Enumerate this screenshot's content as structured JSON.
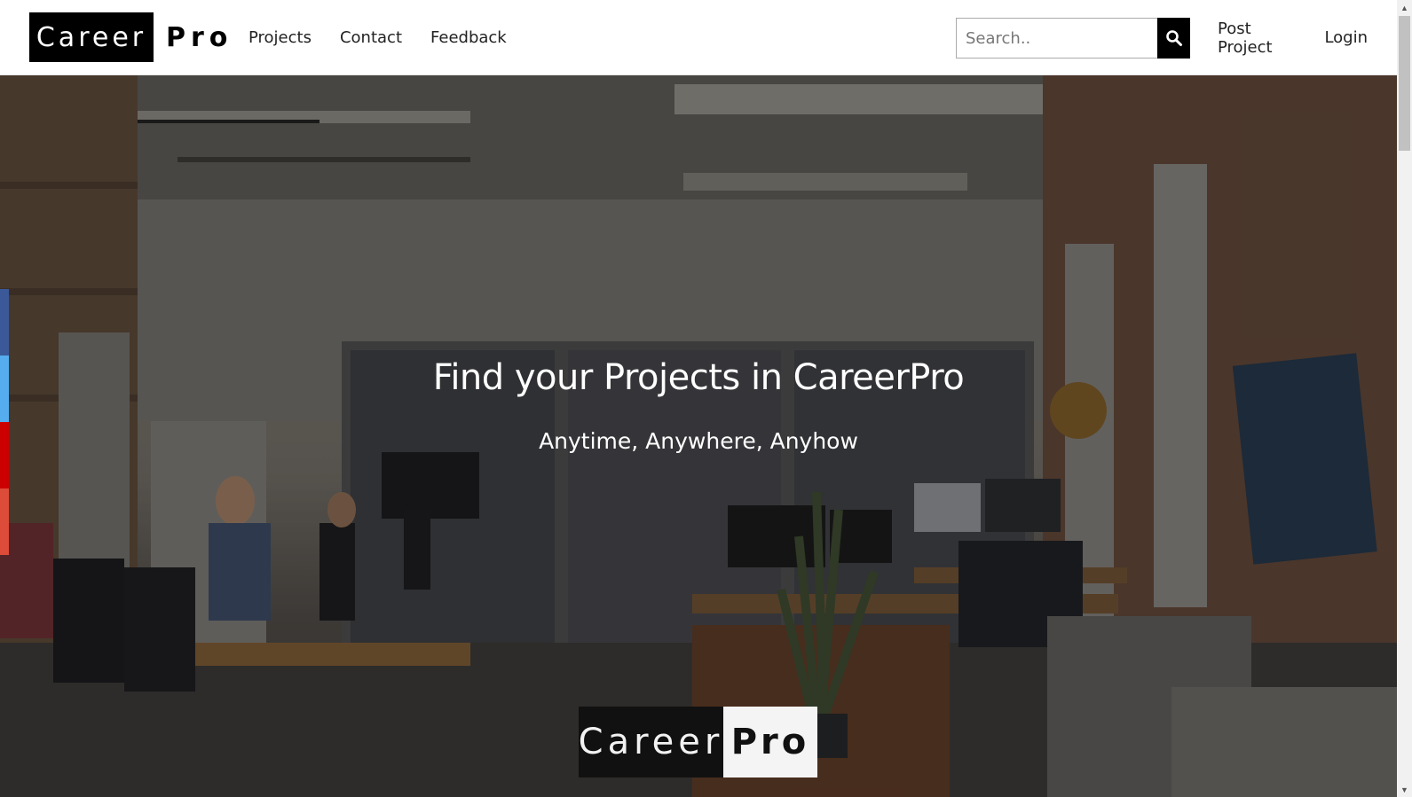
{
  "navbar": {
    "brand_box": "Career",
    "brand_plain": "Pro",
    "links": [
      "Projects",
      "Contact",
      "Feedback"
    ],
    "search_placeholder": "Search..",
    "post_project": "Post Project",
    "login": "Login"
  },
  "hero": {
    "title": "Find your Projects in CareerPro",
    "subtitle": "Anytime, Anywhere, Anyhow",
    "logo_dark": "Career",
    "logo_light": "Pro"
  },
  "social": {
    "colors": [
      "#3b5998",
      "#55acee",
      "#cc0000",
      "#dd4b39"
    ],
    "icons": [
      "facebook-icon",
      "twitter-icon",
      "youtube-icon",
      "google-plus-icon"
    ]
  }
}
